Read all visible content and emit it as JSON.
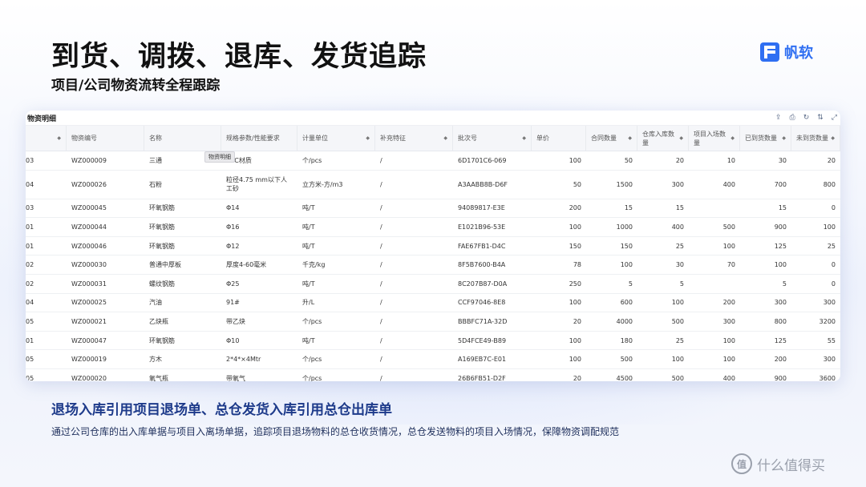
{
  "header": {
    "title": "到货、调拨、退库、发货追踪",
    "subtitle": "项目/公司物资流转全程跟踪",
    "brand": "帆软"
  },
  "panel": {
    "title": "物资明细",
    "tooltip": "物资明细",
    "toolbar": [
      {
        "icon": "upload-icon",
        "glyph": "⇪"
      },
      {
        "icon": "print-icon",
        "glyph": "⎙"
      },
      {
        "icon": "refresh-icon",
        "glyph": "↻"
      },
      {
        "icon": "sort-icon",
        "glyph": "⇅"
      },
      {
        "icon": "fullscreen-icon",
        "glyph": "⤢"
      }
    ]
  },
  "table": {
    "columns": [
      "",
      "物资编号",
      "名称",
      "规格参数/性能要求",
      "计量单位",
      "补充特征",
      "批次号",
      "单价",
      "合同数量",
      "仓库入库数量",
      "项目入场数量",
      "已到货数量",
      "未到货数量"
    ],
    "rows": [
      [
        "03",
        "WZ000009",
        "三通",
        "PVC材质",
        "个/pcs",
        "/",
        "6D1701C6-069",
        "100",
        "50",
        "20",
        "10",
        "30",
        "20"
      ],
      [
        "04",
        "WZ000026",
        "石粉",
        "粒径4.75 mm以下人工砂",
        "立方米-方/m3",
        "/",
        "A3AABB8B-D6F",
        "50",
        "1500",
        "300",
        "400",
        "700",
        "800"
      ],
      [
        "03",
        "WZ000045",
        "环氧钢筋",
        "Φ14",
        "吨/T",
        "/",
        "94089817-E3E",
        "200",
        "15",
        "15",
        "",
        "15",
        "0"
      ],
      [
        "01",
        "WZ000044",
        "环氧钢筋",
        "Φ16",
        "吨/T",
        "/",
        "E1021B96-53E",
        "100",
        "1000",
        "400",
        "500",
        "900",
        "100"
      ],
      [
        "01",
        "WZ000046",
        "环氧钢筋",
        "Φ12",
        "吨/T",
        "/",
        "FAE67FB1-D4C",
        "150",
        "150",
        "25",
        "100",
        "125",
        "25"
      ],
      [
        "02",
        "WZ000030",
        "普通中厚板",
        "厚度4-60毫米",
        "千克/kg",
        "/",
        "8F5B7600-B4A",
        "78",
        "100",
        "30",
        "70",
        "100",
        "0"
      ],
      [
        "02",
        "WZ000031",
        "螺纹钢筋",
        "Φ25",
        "吨/T",
        "/",
        "8C207B87-D0A",
        "250",
        "5",
        "5",
        "",
        "5",
        "0"
      ],
      [
        "04",
        "WZ000025",
        "汽油",
        "91#",
        "升/L",
        "/",
        "CCF97046-8E8",
        "100",
        "600",
        "100",
        "200",
        "300",
        "300"
      ],
      [
        "05",
        "WZ000021",
        "乙炔瓶",
        "带乙炔",
        "个/pcs",
        "/",
        "BBBFC71A-32D",
        "20",
        "4000",
        "500",
        "300",
        "800",
        "3200"
      ],
      [
        "01",
        "WZ000047",
        "环氧钢筋",
        "Φ10",
        "吨/T",
        "/",
        "5D4FCE49-B89",
        "100",
        "180",
        "25",
        "100",
        "125",
        "55"
      ],
      [
        "05",
        "WZ000019",
        "方木",
        "2*4*×4Mtr",
        "个/pcs",
        "/",
        "A169EB7C-E01",
        "100",
        "500",
        "100",
        "100",
        "200",
        "300"
      ],
      [
        "05",
        "WZ000020",
        "氧气瓶",
        "带氧气",
        "个/pcs",
        "/",
        "26B6FB51-D2F",
        "20",
        "4500",
        "500",
        "400",
        "900",
        "3600"
      ]
    ]
  },
  "footer": {
    "heading": "退场入库引用项目退场单、总仓发货入库引用总仓出库单",
    "description": "通过公司仓库的出入库单据与项目入离场单据，追踪项目退场物料的总仓收货情况，总仓发送物料的项目入场情况，保障物资调配规范",
    "watermark": "什么值得买",
    "watermark_icon": "值"
  }
}
